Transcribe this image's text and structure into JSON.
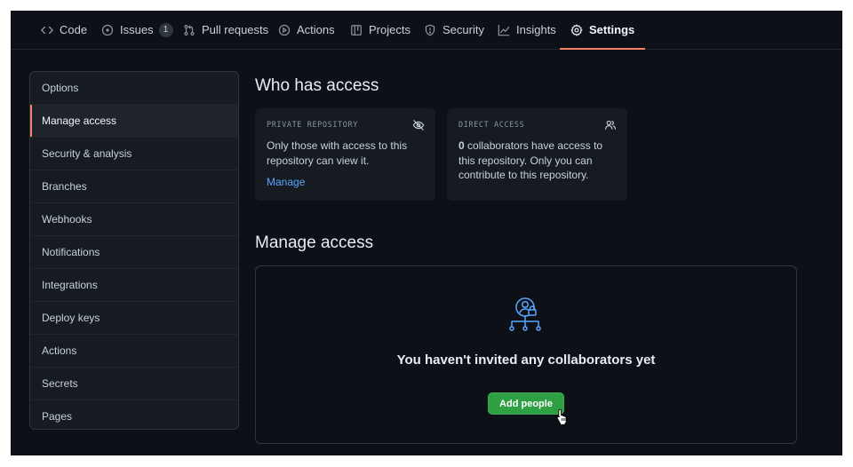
{
  "nav": {
    "tabs": [
      {
        "label": "Code",
        "icon": "code-icon"
      },
      {
        "label": "Issues",
        "icon": "issue-opened-icon",
        "count": "1"
      },
      {
        "label": "Pull requests",
        "icon": "git-pull-request-icon"
      },
      {
        "label": "Actions",
        "icon": "play-icon"
      },
      {
        "label": "Projects",
        "icon": "table-icon"
      },
      {
        "label": "Security",
        "icon": "shield-icon"
      },
      {
        "label": "Insights",
        "icon": "graph-icon"
      },
      {
        "label": "Settings",
        "icon": "gear-icon",
        "active": true
      }
    ],
    "active_underline_color": "#f78166"
  },
  "sidebar": {
    "items": [
      {
        "label": "Options"
      },
      {
        "label": "Manage access",
        "selected": true
      },
      {
        "label": "Security & analysis"
      },
      {
        "label": "Branches"
      },
      {
        "label": "Webhooks"
      },
      {
        "label": "Notifications"
      },
      {
        "label": "Integrations"
      },
      {
        "label": "Deploy keys"
      },
      {
        "label": "Actions"
      },
      {
        "label": "Secrets"
      },
      {
        "label": "Pages"
      }
    ]
  },
  "who_has_access": {
    "title": "Who has access",
    "private_card": {
      "label": "PRIVATE REPOSITORY",
      "icon": "eye-closed-icon",
      "text": "Only those with access to this repository can view it.",
      "link": "Manage"
    },
    "direct_card": {
      "label": "DIRECT ACCESS",
      "icon": "people-icon",
      "count": "0",
      "text": " collaborators have access to this repository. Only you can contribute to this repository."
    }
  },
  "manage_access": {
    "title": "Manage access",
    "empty_icon": "organization-lock-icon",
    "empty_title": "You haven't invited any collaborators yet",
    "add_button": "Add people",
    "button_color": "#2ea043",
    "accent_color": "#58a6ff"
  }
}
